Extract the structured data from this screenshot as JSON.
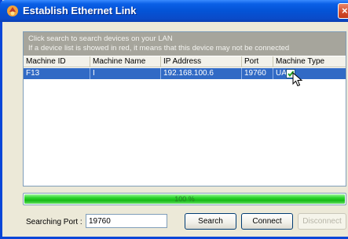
{
  "window": {
    "title": "Establish Ethernet Link",
    "close_glyph": "×"
  },
  "info": {
    "line1": "Click search to search devices on your LAN",
    "line2": "If a device list is showed in red, it means that this device may not be connected"
  },
  "table": {
    "columns": [
      "Machine ID",
      "Machine Name",
      "IP Address",
      "Port",
      "Machine Type"
    ],
    "rows": [
      {
        "machine_id": "F13",
        "machine_name": "I",
        "ip_address": "192.168.100.6",
        "port": "19760",
        "machine_type": "UAP",
        "checked": true,
        "selected": true
      }
    ]
  },
  "progress": {
    "value": 1.0,
    "label": "100 %"
  },
  "port": {
    "label": "Searching Port :",
    "value": "19760"
  },
  "buttons": {
    "search": "Search",
    "connect": "Connect",
    "disconnect": "Disconnect"
  },
  "colors": {
    "selection": "#316ac5",
    "progress_fill": "#2ed62e",
    "titlebar": "#0453d6"
  },
  "icons": {
    "app": "app-logo-icon",
    "close": "close-icon",
    "cursor": "mouse-pointer-icon",
    "check": "checkmark-icon"
  }
}
